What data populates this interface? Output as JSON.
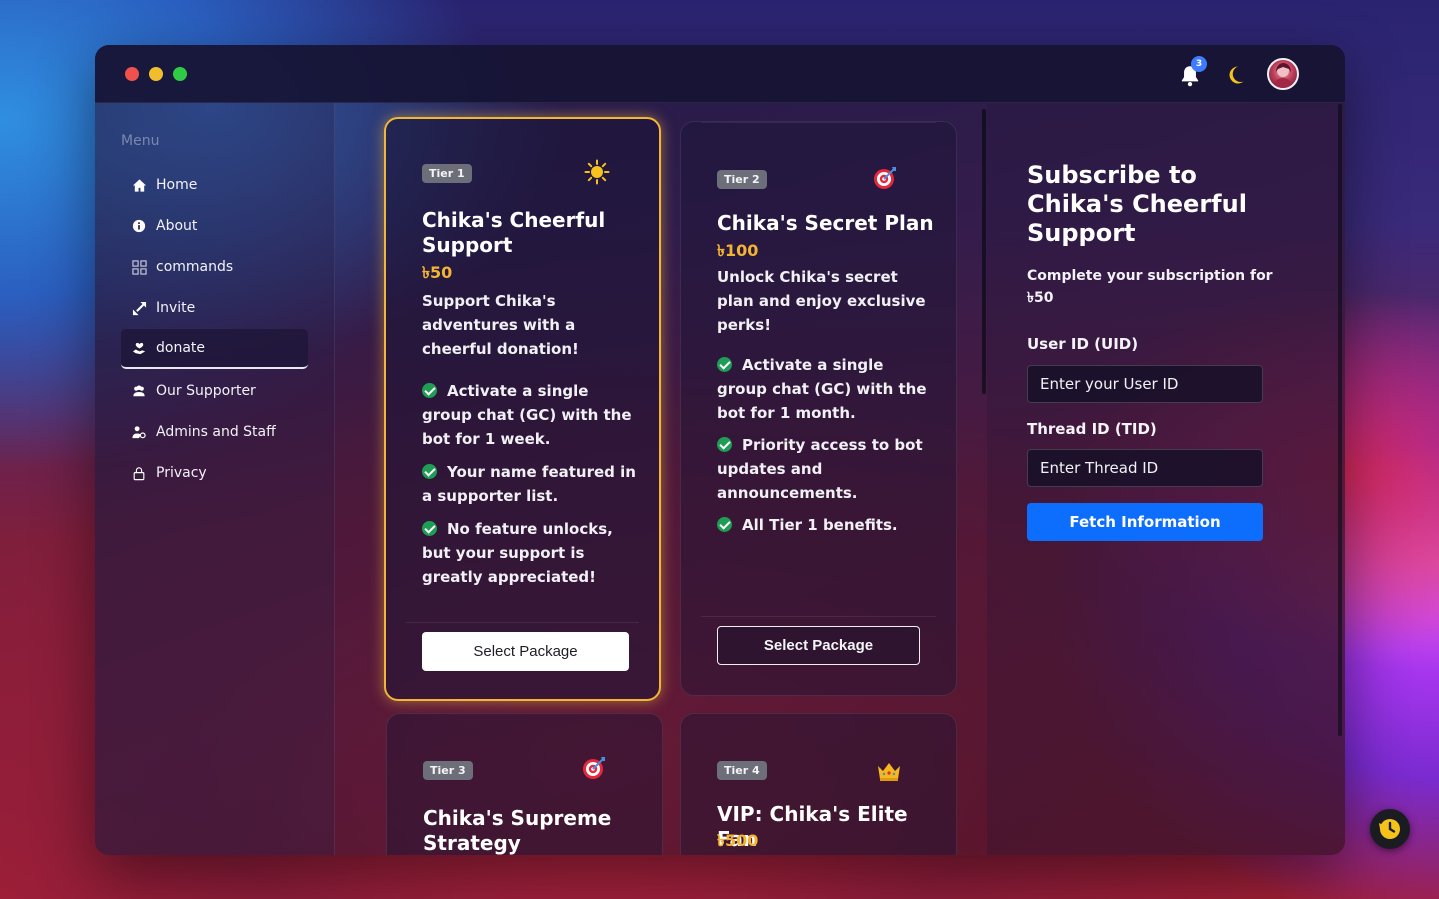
{
  "header": {
    "notification_count": "3"
  },
  "sidebar": {
    "menu_title": "Menu",
    "items": [
      {
        "label": "Home",
        "icon": "home-icon"
      },
      {
        "label": "About",
        "icon": "info-icon"
      },
      {
        "label": "commands",
        "icon": "grid-icon"
      },
      {
        "label": "Invite",
        "icon": "link-arrow-icon"
      },
      {
        "label": "donate",
        "icon": "donate-icon",
        "active": true
      },
      {
        "label": "Our Supporter",
        "icon": "users-icon"
      },
      {
        "label": "Admins and Staff",
        "icon": "staff-icon"
      },
      {
        "label": "Privacy",
        "icon": "lock-icon"
      }
    ]
  },
  "tiers": [
    {
      "badge": "Tier 1",
      "icon": "sun-icon",
      "title": "Chika's Cheerful Support",
      "price": "৳50",
      "description": "Support Chika's adventures with a cheerful donation!",
      "features": [
        "Activate a single group chat (GC) with the bot for 1 week.",
        "Your name featured in a supporter list.",
        "No feature unlocks, but your support is greatly appreciated!"
      ],
      "button": "Select Package"
    },
    {
      "badge": "Tier 2",
      "icon": "target-icon",
      "title": "Chika's Secret Plan",
      "price": "৳100",
      "description": "Unlock Chika's secret plan and enjoy exclusive perks!",
      "features": [
        "Activate a single group chat (GC) with the bot for 1 month.",
        "Priority access to bot updates and announcements.",
        "All Tier 1 benefits."
      ],
      "button": "Select Package"
    },
    {
      "badge": "Tier 3",
      "icon": "target-icon",
      "title": "Chika's Supreme Strategy",
      "price": "৳"
    },
    {
      "badge": "Tier 4",
      "icon": "crown-icon",
      "title": "VIP: Chika's Elite Fan",
      "price": "৳500"
    }
  ],
  "subscribe": {
    "title": "Subscribe to Chika's Cheerful Support",
    "subtitle": "Complete your subscription for ৳50",
    "uid_label": "User ID (UID)",
    "uid_placeholder": "Enter your User ID",
    "tid_label": "Thread ID (TID)",
    "tid_placeholder": "Enter Thread ID",
    "button": "Fetch Information"
  },
  "colors": {
    "accent_blue": "#0d6efd",
    "price_gold": "#f2b431",
    "featured_border": "#f1b53a",
    "check_green": "#1f9d55"
  }
}
